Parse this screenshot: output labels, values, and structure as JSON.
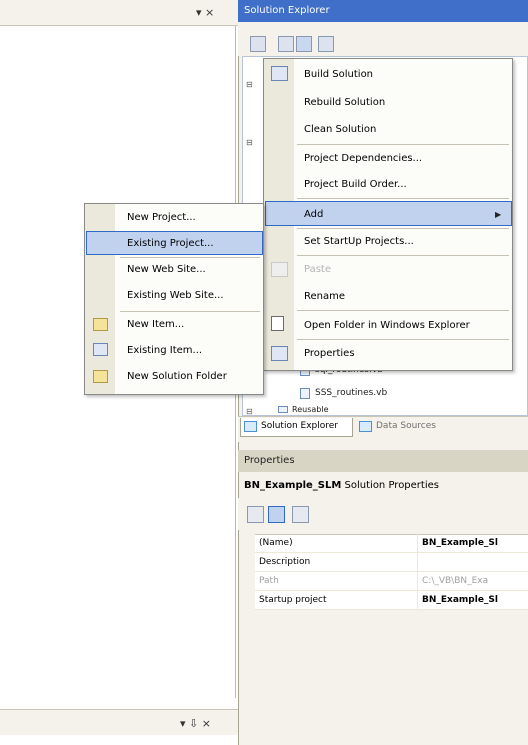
{
  "left_pane": {
    "top_controls": "▾ ×",
    "bottom_controls": "▾ ⇩ ×"
  },
  "solution_explorer": {
    "title": "Solution Explorer",
    "tree_items": [
      "sql_routines.vb",
      "SSS_routines.vb",
      "Reusable"
    ],
    "tabs": [
      "Solution Explorer",
      "Data Sources"
    ]
  },
  "context_menu": {
    "items": [
      {
        "label": "Build Solution",
        "icon": "build-icon"
      },
      {
        "label": "Rebuild Solution"
      },
      {
        "label": "Clean Solution"
      },
      {
        "label": "Project Dependencies..."
      },
      {
        "label": "Project Build Order..."
      },
      {
        "label": "Add",
        "highlighted": true,
        "has_submenu": true
      },
      {
        "label": "Set StartUp Projects..."
      },
      {
        "label": "Paste",
        "disabled": true,
        "icon": "paste-icon"
      },
      {
        "label": "Rename"
      },
      {
        "label": "Open Folder in Windows Explorer",
        "icon": "open-folder-icon"
      },
      {
        "label": "Properties",
        "icon": "properties-icon"
      }
    ],
    "submenu_arrow": "▶"
  },
  "add_submenu": {
    "items": [
      {
        "label": "New Project..."
      },
      {
        "label": "Existing Project...",
        "highlighted": true
      },
      {
        "label": "New Web Site..."
      },
      {
        "label": "Existing Web Site..."
      },
      {
        "label": "New Item...",
        "icon": "new-item-icon"
      },
      {
        "label": "Existing Item...",
        "icon": "existing-item-icon"
      },
      {
        "label": "New Solution Folder",
        "icon": "solution-folder-icon"
      }
    ]
  },
  "properties": {
    "title": "Properties",
    "object_name": "BN_Example_SLM",
    "object_type": "Solution Properties",
    "rows": [
      {
        "name": "(Name)",
        "value": "BN_Example_Sl",
        "bold": true
      },
      {
        "name": "Description",
        "value": ""
      },
      {
        "name": "Path",
        "value": "C:\\_VB\\BN_Exa",
        "grey": true
      },
      {
        "name": "Startup project",
        "value": "BN_Example_Sl",
        "bold": true
      }
    ]
  },
  "colors": {
    "accent": "#316ac5",
    "highlight": "#c1d2ee",
    "title_bar": "#3f6fc8",
    "chrome": "#f4f2ea"
  }
}
